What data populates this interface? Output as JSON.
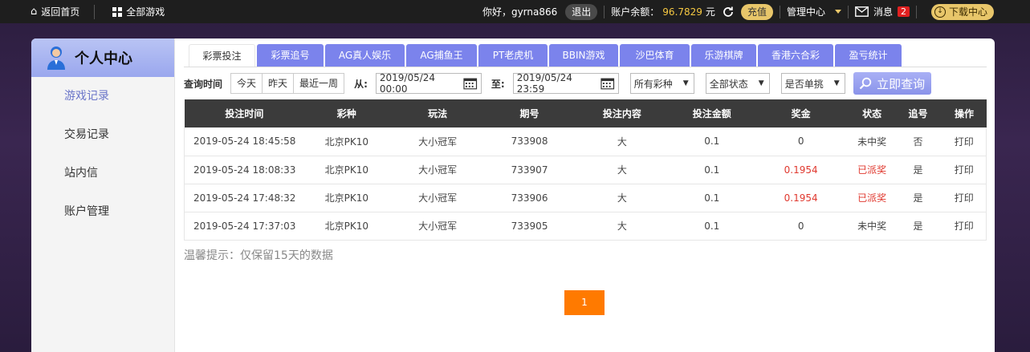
{
  "topbar": {
    "home": "返回首页",
    "all_games": "全部游戏",
    "greeting": "你好，gyrna866",
    "logout": "退出",
    "balance_label": "账户余额：",
    "balance": "96.7829",
    "unit": "元",
    "recharge": "充值",
    "manage": "管理中心",
    "messages": "消息",
    "msg_count": "2",
    "download": "下载中心"
  },
  "sidebar": {
    "title": "个人中心",
    "items": [
      {
        "label": "游戏记录"
      },
      {
        "label": "交易记录"
      },
      {
        "label": "站内信"
      },
      {
        "label": "账户管理"
      }
    ]
  },
  "tabs": [
    {
      "label": "彩票投注"
    },
    {
      "label": "彩票追号"
    },
    {
      "label": "AG真人娱乐"
    },
    {
      "label": "AG捕鱼王"
    },
    {
      "label": "PT老虎机"
    },
    {
      "label": "BBIN游戏"
    },
    {
      "label": "沙巴体育"
    },
    {
      "label": "乐游棋牌"
    },
    {
      "label": "香港六合彩"
    },
    {
      "label": "盈亏统计"
    }
  ],
  "filters": {
    "query_time": "查询时间",
    "today": "今天",
    "yesterday": "昨天",
    "last_week": "最近一周",
    "from": "从:",
    "from_date": "2019/05/24 00:00",
    "to": "至:",
    "to_date": "2019/05/24 23:59",
    "lottery_select": "所有彩种",
    "status_select": "全部状态",
    "single_select": "是否单挑",
    "query_btn": "立即查询"
  },
  "table": {
    "headers": [
      "投注时间",
      "彩种",
      "玩法",
      "期号",
      "投注内容",
      "投注金额",
      "奖金",
      "状态",
      "追号",
      "操作"
    ],
    "rows": [
      [
        "2019-05-24 18:45:58",
        "北京PK10",
        "大小冠军",
        "733908",
        "大",
        "0.1",
        "0",
        "未中奖",
        "否",
        "打印"
      ],
      [
        "2019-05-24 18:08:33",
        "北京PK10",
        "大小冠军",
        "733907",
        "大",
        "0.1",
        "0.1954",
        "已派奖",
        "是",
        "打印"
      ],
      [
        "2019-05-24 17:48:32",
        "北京PK10",
        "大小冠军",
        "733906",
        "大",
        "0.1",
        "0.1954",
        "已派奖",
        "是",
        "打印"
      ],
      [
        "2019-05-24 17:37:03",
        "北京PK10",
        "大小冠军",
        "733905",
        "大",
        "0.1",
        "0",
        "未中奖",
        "是",
        "打印"
      ]
    ]
  },
  "tip": "温馨提示：仅保留15天的数据",
  "pager": {
    "current": "1"
  },
  "colors": {
    "accent": "#7b83ec",
    "orange": "#ff7a00",
    "gold": "#e8c66a",
    "win_red": "#e0392f"
  }
}
